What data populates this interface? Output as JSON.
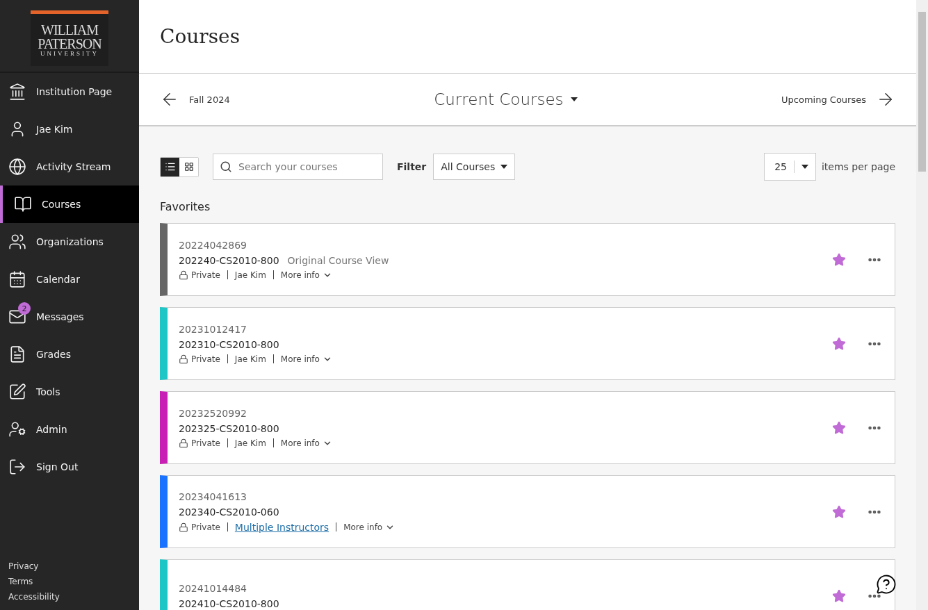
{
  "logo": {
    "lines": [
      "WILLIAM",
      "PATERSON",
      "UNIVERSITY"
    ]
  },
  "sidebar": {
    "items": [
      {
        "kind": "institution",
        "label": "Institution Page",
        "selected": false
      },
      {
        "kind": "profile",
        "label": "Jae Kim",
        "selected": false
      },
      {
        "kind": "activity",
        "label": "Activity Stream",
        "selected": false
      },
      {
        "kind": "courses",
        "label": "Courses",
        "selected": true
      },
      {
        "kind": "organizations",
        "label": "Organizations",
        "selected": false
      },
      {
        "kind": "calendar",
        "label": "Calendar",
        "selected": false
      },
      {
        "kind": "messages",
        "label": "Messages",
        "selected": false,
        "badge": "2"
      },
      {
        "kind": "grades",
        "label": "Grades",
        "selected": false
      },
      {
        "kind": "tools",
        "label": "Tools",
        "selected": false
      },
      {
        "kind": "admin",
        "label": "Admin",
        "selected": false
      },
      {
        "kind": "signout",
        "label": "Sign Out",
        "selected": false
      }
    ],
    "footer_links": [
      "Privacy",
      "Terms",
      "Accessibility"
    ]
  },
  "page_title": "Courses",
  "term_nav": {
    "previous": "Fall 2024",
    "current": "Current Courses",
    "next": "Upcoming Courses"
  },
  "toolbar": {
    "view_toggle": [
      {
        "kind": "list",
        "selected": true
      },
      {
        "kind": "grid",
        "selected": false
      }
    ],
    "search": {
      "placeholder": "Search your courses"
    },
    "filter_label": "Filter",
    "filter_value": "All Courses",
    "page_size": "25",
    "page_size_label": "items per page"
  },
  "section_title": "Favorites",
  "courses": [
    {
      "id": "20224042869",
      "name": "202240-CS2010-800",
      "note": "Original Course View",
      "color": "#666666",
      "favorite": true,
      "privacy": "Private",
      "instructor": {
        "kind": "text",
        "label": "Jae Kim"
      },
      "more": "More info"
    },
    {
      "id": "20231012417",
      "name": "202310-CS2010-800",
      "color": "#1fc6c6",
      "favorite": true,
      "privacy": "Private",
      "instructor": {
        "kind": "text",
        "label": "Jae Kim"
      },
      "more": "More info"
    },
    {
      "id": "20232520992",
      "name": "202325-CS2010-800",
      "color": "#c81fb4",
      "favorite": true,
      "privacy": "Private",
      "instructor": {
        "kind": "text",
        "label": "Jae Kim"
      },
      "more": "More info"
    },
    {
      "id": "20234041613",
      "name": "202340-CS2010-060",
      "color": "#1a73ff",
      "favorite": true,
      "privacy": "Private",
      "instructor": {
        "kind": "link",
        "label": "Multiple Instructors"
      },
      "more": "More info"
    },
    {
      "id": "20241014484",
      "name": "202410-CS2010-800",
      "color": "#1fc6c6",
      "favorite": true
    }
  ]
}
